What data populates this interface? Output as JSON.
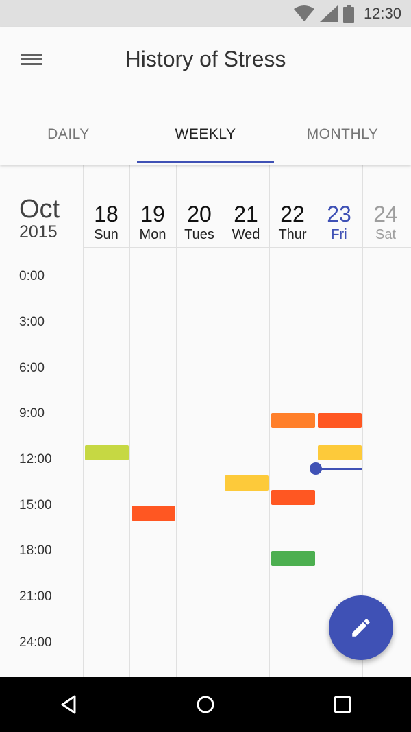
{
  "status_bar": {
    "time": "12:30",
    "icons": [
      "wifi-icon",
      "signal-icon",
      "battery-icon"
    ]
  },
  "app_bar": {
    "title": "History of Stress",
    "menu_icon": "menu-icon"
  },
  "tabs": [
    {
      "label": "DAILY",
      "active": false
    },
    {
      "label": "WEEKLY",
      "active": true
    },
    {
      "label": "MONTHLY",
      "active": false
    }
  ],
  "calendar": {
    "month": "Oct",
    "year": "2015",
    "days": [
      {
        "num": "18",
        "name": "Sun",
        "state": "past"
      },
      {
        "num": "19",
        "name": "Mon",
        "state": "past"
      },
      {
        "num": "20",
        "name": "Tues",
        "state": "past"
      },
      {
        "num": "21",
        "name": "Wed",
        "state": "past"
      },
      {
        "num": "22",
        "name": "Thur",
        "state": "past"
      },
      {
        "num": "23",
        "name": "Fri",
        "state": "today"
      },
      {
        "num": "24",
        "name": "Sat",
        "state": "future"
      }
    ],
    "times": [
      "0:00",
      "3:00",
      "6:00",
      "9:00",
      "12:00",
      "15:00",
      "18:00",
      "21:00",
      "24:00"
    ],
    "colors": {
      "yellow_green": "#c6d843",
      "orange": "#ff7f2a",
      "red_orange": "#ff5722",
      "yellow": "#fdca3a",
      "green": "#4caf50",
      "accent": "#3f51b5"
    },
    "events": [
      {
        "day": "18",
        "start": "11:00",
        "color": "#c6d843"
      },
      {
        "day": "19",
        "start": "15:00",
        "color": "#ff5722"
      },
      {
        "day": "21",
        "start": "13:30",
        "color": "#fdca3a"
      },
      {
        "day": "22",
        "start": "9:00",
        "color": "#ff7f2a"
      },
      {
        "day": "22",
        "start": "14:00",
        "color": "#ff5722"
      },
      {
        "day": "22",
        "start": "18:00",
        "color": "#4caf50"
      },
      {
        "day": "23",
        "start": "9:00",
        "color": "#ff5722"
      },
      {
        "day": "23",
        "start": "11:00",
        "color": "#fdca3a"
      }
    ]
  },
  "fab": {
    "icon": "pencil-icon"
  },
  "nav_bar": {
    "icons": [
      "back-icon",
      "home-icon",
      "recents-icon"
    ]
  }
}
